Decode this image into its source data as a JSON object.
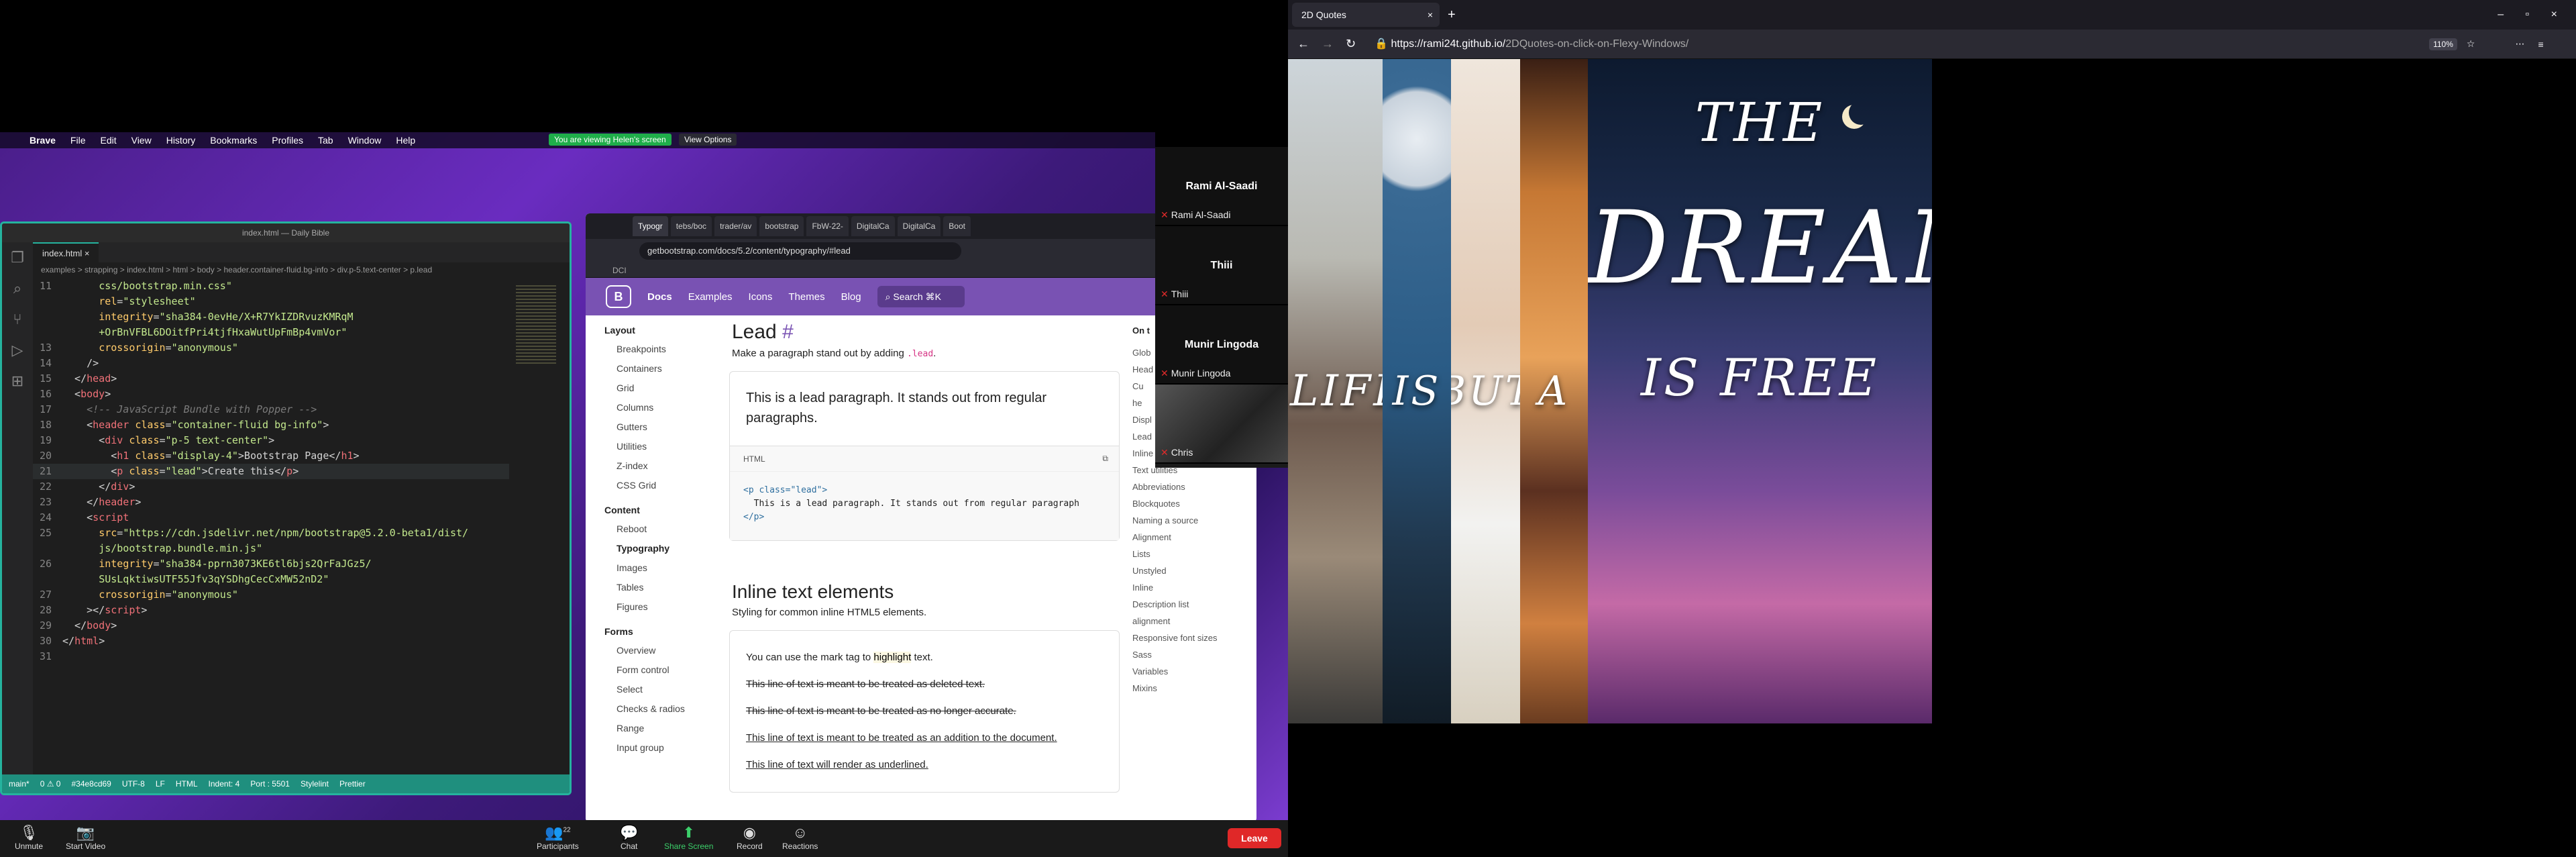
{
  "mac_menu": {
    "brand": "Brave",
    "items": [
      "File",
      "Edit",
      "View",
      "History",
      "Bookmarks",
      "Profiles",
      "Tab",
      "Window",
      "Help"
    ],
    "share_notice": "You are viewing Helen's screen",
    "view_options": "View Options"
  },
  "vscode": {
    "title": "index.html — Daily Bible",
    "tab": "index.html",
    "breadcrumb": "examples > strapping > index.html > html > body > header.container-fluid.bg-info > div.p-5.text-center > p.lead",
    "lines": [
      {
        "n": "11",
        "html": "      <span class='t-str'>css/bootstrap.min.css\"</span>"
      },
      {
        "n": "",
        "html": "      <span class='t-attr'>rel</span>=<span class='t-str'>\"stylesheet\"</span>"
      },
      {
        "n": "",
        "html": "      <span class='t-attr'>integrity</span>=<span class='t-str'>\"sha384-0evHe/X+R7YkIZDRvuzKMRqM</span>"
      },
      {
        "n": "",
        "html": "      <span class='t-str'>+OrBnVFBL6DOitfPri4tjfHxaWutUpFmBp4vmVor\"</span>"
      },
      {
        "n": "13",
        "html": "      <span class='t-attr'>crossorigin</span>=<span class='t-str'>\"anonymous\"</span>"
      },
      {
        "n": "14",
        "html": "    /&gt;"
      },
      {
        "n": "15",
        "html": "  &lt;/<span class='t-tag'>head</span>&gt;"
      },
      {
        "n": "16",
        "html": "  &lt;<span class='t-tag'>body</span>&gt;"
      },
      {
        "n": "17",
        "html": "    <span class='t-com'>&lt;!-- JavaScript Bundle with Popper --&gt;</span>"
      },
      {
        "n": "18",
        "html": "    &lt;<span class='t-tag'>header</span> <span class='t-attr'>class</span>=<span class='t-str'>\"container-fluid bg-info\"</span>&gt;"
      },
      {
        "n": "19",
        "html": "      &lt;<span class='t-tag'>div</span> <span class='t-attr'>class</span>=<span class='t-str'>\"p-5 text-center\"</span>&gt;"
      },
      {
        "n": "20",
        "html": "        &lt;<span class='t-tag'>h1</span> <span class='t-attr'>class</span>=<span class='t-str'>\"display-4\"</span>&gt;Bootstrap Page&lt;/<span class='t-tag'>h1</span>&gt;"
      },
      {
        "n": "21",
        "html": "        &lt;<span class='t-tag'>p</span> <span class='t-attr'>class</span>=<span class='t-str'>\"lead\"</span>&gt;Create this&lt;/<span class='t-tag'>p</span>&gt;",
        "current": true
      },
      {
        "n": "22",
        "html": "      &lt;/<span class='t-tag'>div</span>&gt;"
      },
      {
        "n": "23",
        "html": "    &lt;/<span class='t-tag'>header</span>&gt;"
      },
      {
        "n": "24",
        "html": "    &lt;<span class='t-tag'>script</span>"
      },
      {
        "n": "25",
        "html": "      <span class='t-attr'>src</span>=<span class='t-str'>\"https://cdn.jsdelivr.net/npm/bootstrap@5.2.0-beta1/dist/</span>"
      },
      {
        "n": "",
        "html": "      <span class='t-str'>js/bootstrap.bundle.min.js\"</span>"
      },
      {
        "n": "26",
        "html": "      <span class='t-attr'>integrity</span>=<span class='t-str'>\"sha384-pprn3073KE6tl6bjs2QrFaJGz5/</span>"
      },
      {
        "n": "",
        "html": "      <span class='t-str'>SUsLqktiwsUTF55Jfv3qYSDhgCecCxMW52nD2\"</span>"
      },
      {
        "n": "27",
        "html": "      <span class='t-attr'>crossorigin</span>=<span class='t-str'>\"anonymous\"</span>"
      },
      {
        "n": "28",
        "html": "    &gt;&lt;/<span class='t-tag'>script</span>&gt;"
      },
      {
        "n": "29",
        "html": "  &lt;/<span class='t-tag'>body</span>&gt;"
      },
      {
        "n": "30",
        "html": "&lt;/<span class='t-tag'>html</span>&gt;"
      },
      {
        "n": "31",
        "html": ""
      }
    ],
    "status": {
      "branch": "main*",
      "errors": "0 ⚠ 0",
      "commit": "#34e8cd69",
      "encoding": "UTF-8",
      "eol": "LF",
      "lang": "HTML",
      "indent": "Indent: 4",
      "port": "Port : 5501",
      "lint": "Stylelint",
      "prettier": "Prettier"
    }
  },
  "browser": {
    "tabs": [
      "Typogr",
      "tebs/boc",
      "trader/av",
      "bootstrap",
      "FbW-22-",
      "DigitalCa",
      "DigitalCa",
      "Boot"
    ],
    "url": "getbootstrap.com/docs/5.2/content/typography/#lead",
    "bookmark": "DCI",
    "nav": [
      "Docs",
      "Examples",
      "Icons",
      "Themes",
      "Blog"
    ],
    "search_placeholder": "Search",
    "search_kbd": "⌘K",
    "sidebar": [
      {
        "group": "Layout",
        "items": [
          "Breakpoints",
          "Containers",
          "Grid",
          "Columns",
          "Gutters",
          "Utilities",
          "Z-index",
          "CSS Grid"
        ]
      },
      {
        "group": "Content",
        "items": [
          "Reboot",
          "Typography",
          "Images",
          "Tables",
          "Figures"
        ]
      },
      {
        "group": "Forms",
        "items": [
          "Overview",
          "Form control",
          "Select",
          "Checks & radios",
          "Range",
          "Input group"
        ]
      }
    ],
    "lead_heading": "Lead",
    "lead_desc_1": "Make a paragraph stand out by adding",
    "lead_desc_code": ".lead",
    "lead_example": "This is a lead paragraph. It stands out from regular paragraphs.",
    "code_label": "HTML",
    "code_line1": "<p class=\"lead\">",
    "code_line2": "  This is a lead paragraph. It stands out from regular paragraph",
    "code_line3": "</p>",
    "inline_heading": "Inline text elements",
    "inline_desc": "Styling for common inline HTML5 elements.",
    "inline_mark_pre": "You can use the mark tag to",
    "inline_mark": "highlight",
    "inline_mark_post": "text.",
    "inline_del": "This line of text is meant to be treated as deleted text.",
    "inline_s": "This line of text is meant to be treated as no longer accurate.",
    "inline_ins": "This line of text is meant to be treated as an addition to the document.",
    "inline_u": "This line of text will render as underlined.",
    "toc_title": "On t",
    "toc": [
      "Glob",
      "Head",
      "Cu",
      "he",
      "Displ",
      "Lead",
      "Inline text elements",
      "Text utilities",
      "Abbreviations",
      "Blockquotes",
      "Naming a source",
      "Alignment",
      "Lists",
      "Unstyled",
      "Inline",
      "Description list",
      "alignment",
      "Responsive font sizes",
      "Sass",
      "Variables",
      "Mixins"
    ]
  },
  "participants": [
    {
      "name": "Rami Al-Saadi",
      "label": "Rami Al-Saadi"
    },
    {
      "name": "Thiii",
      "label": "Thiii"
    },
    {
      "name": "Munir Lingoda",
      "label": "Munir Lingoda"
    },
    {
      "name": "",
      "label": "Chris"
    }
  ],
  "zoom": {
    "unmute": "Unmute",
    "start_video": "Start Video",
    "participants": "Participants",
    "participants_count": "22",
    "chat": "Chat",
    "share": "Share Screen",
    "record": "Record",
    "reactions": "Reactions",
    "leave": "Leave"
  },
  "firefox": {
    "tab_title": "2D Quotes",
    "url_prefix": "https://rami24t.github.io/",
    "url_path": "2DQuotes-on-click-on-Flexy-Windows/",
    "zoom_level": "110%"
  },
  "quote_words": [
    "LIFE",
    "IS",
    "BUT",
    "A",
    "THE",
    "DREAM",
    "IS FREE"
  ],
  "colors": {
    "accent_teal": "#25b39e",
    "bootstrap_purple": "#7952b3",
    "leave_red": "#e02828"
  }
}
